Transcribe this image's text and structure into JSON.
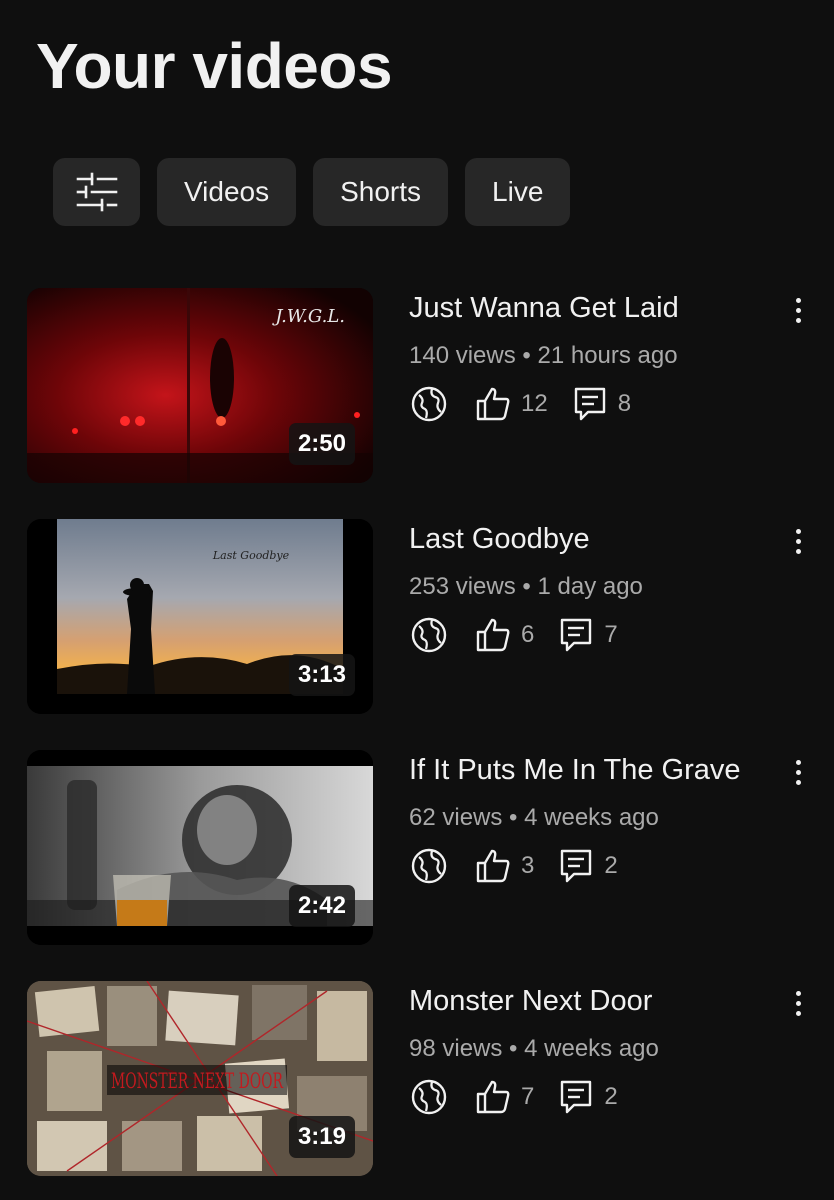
{
  "page": {
    "title": "Your videos"
  },
  "chips": {
    "videos": "Videos",
    "shorts": "Shorts",
    "live": "Live"
  },
  "videos": [
    {
      "title": "Just Wanna Get Laid",
      "views": "140 views",
      "age": "21 hours ago",
      "likes": "12",
      "comments": "8",
      "duration": "2:50",
      "thumb_text": "J.W.G.L."
    },
    {
      "title": "Last Goodbye",
      "views": "253 views",
      "age": "1 day ago",
      "likes": "6",
      "comments": "7",
      "duration": "3:13",
      "thumb_text": "Last Goodbye"
    },
    {
      "title": "If It Puts Me In The Grave",
      "views": "62 views",
      "age": "4 weeks ago",
      "likes": "3",
      "comments": "2",
      "duration": "2:42"
    },
    {
      "title": "Monster Next Door",
      "views": "98 views",
      "age": "4 weeks ago",
      "likes": "7",
      "comments": "2",
      "duration": "3:19",
      "thumb_text": "MONSTER NEXT DOOR"
    }
  ],
  "meta_separator": " • ",
  "icons": {
    "filter": "sliders-filter-icon",
    "visibility": "globe-public-icon",
    "likes": "thumbs-up-icon",
    "comments": "comment-icon",
    "more": "more-vertical-icon"
  },
  "colors": {
    "background": "#0f0f0f",
    "chip": "#272727",
    "text": "#f1f1f1",
    "secondary_text": "#aaaaaa"
  }
}
